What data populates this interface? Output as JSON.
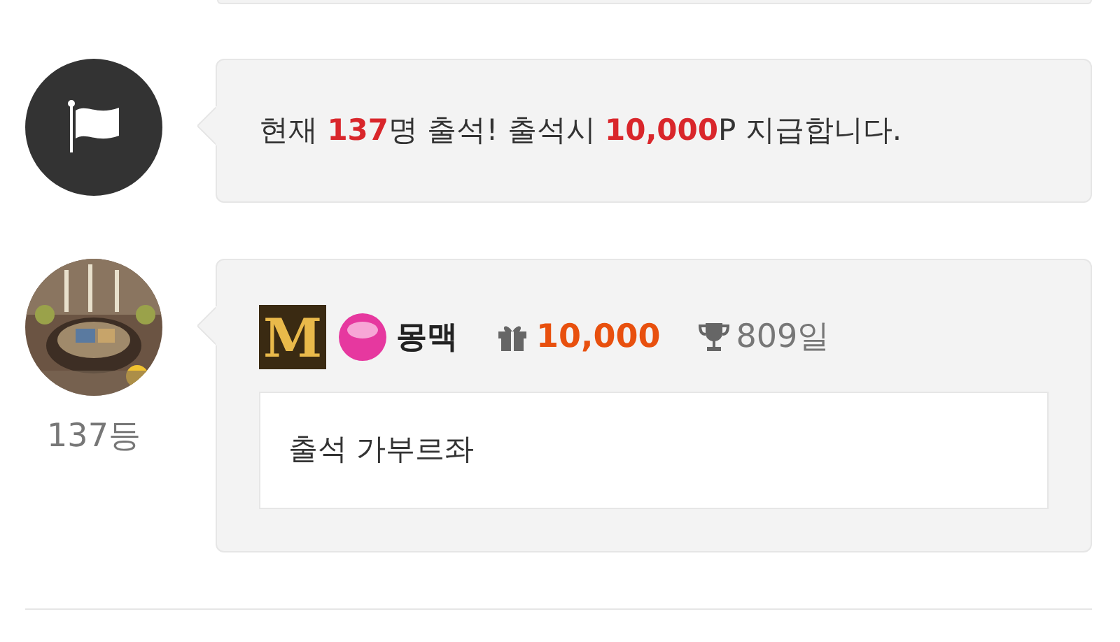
{
  "notice": {
    "message": "현재 **137**명 출석! 출석시 **10,000**P 지급합니다."
  },
  "entries": [
    {
      "rank": "137등",
      "level_badge": "M",
      "name": "몽맥",
      "points": "10,000",
      "days": "809일",
      "comment": "출석 가부르좌"
    }
  ]
}
